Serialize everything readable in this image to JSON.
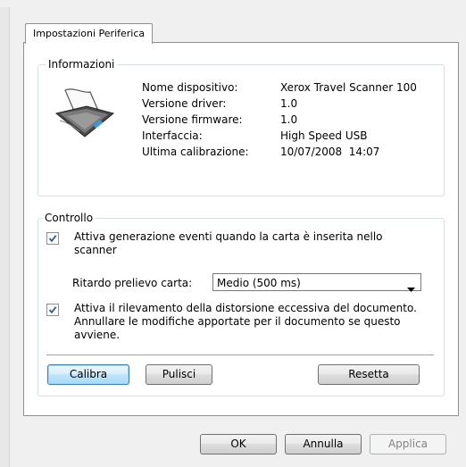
{
  "tab": {
    "label": "Impostazioni Periferica"
  },
  "info": {
    "legend": "Informazioni",
    "rows": [
      {
        "label": "Nome dispositivo:",
        "value": "Xerox Travel Scanner 100"
      },
      {
        "label": "Versione driver:",
        "value": "1.0"
      },
      {
        "label": "Versione firmware:",
        "value": "1.0"
      },
      {
        "label": "Interfaccia:",
        "value": "High Speed USB"
      },
      {
        "label": "Ultima calibrazione:",
        "value": "10/07/2008  14:07"
      }
    ]
  },
  "control": {
    "legend": "Controllo",
    "event_checkbox": {
      "checked": true,
      "label": "Attiva generazione eventi quando la carta è inserita nello scanner"
    },
    "delay_label": "Ritardo prelievo carta:",
    "delay_select": {
      "value": "Medio (500 ms)"
    },
    "skew_checkbox": {
      "checked": true,
      "label": "Attiva il rilevamento della distorsione eccessiva del documento. Annullare le modifiche apportate per il documento se questo avviene."
    },
    "buttons": {
      "calibrate": "Calibra",
      "clean": "Pulisci",
      "reset": "Resetta"
    }
  },
  "footer": {
    "ok": "OK",
    "cancel": "Annulla",
    "apply": "Applica"
  }
}
